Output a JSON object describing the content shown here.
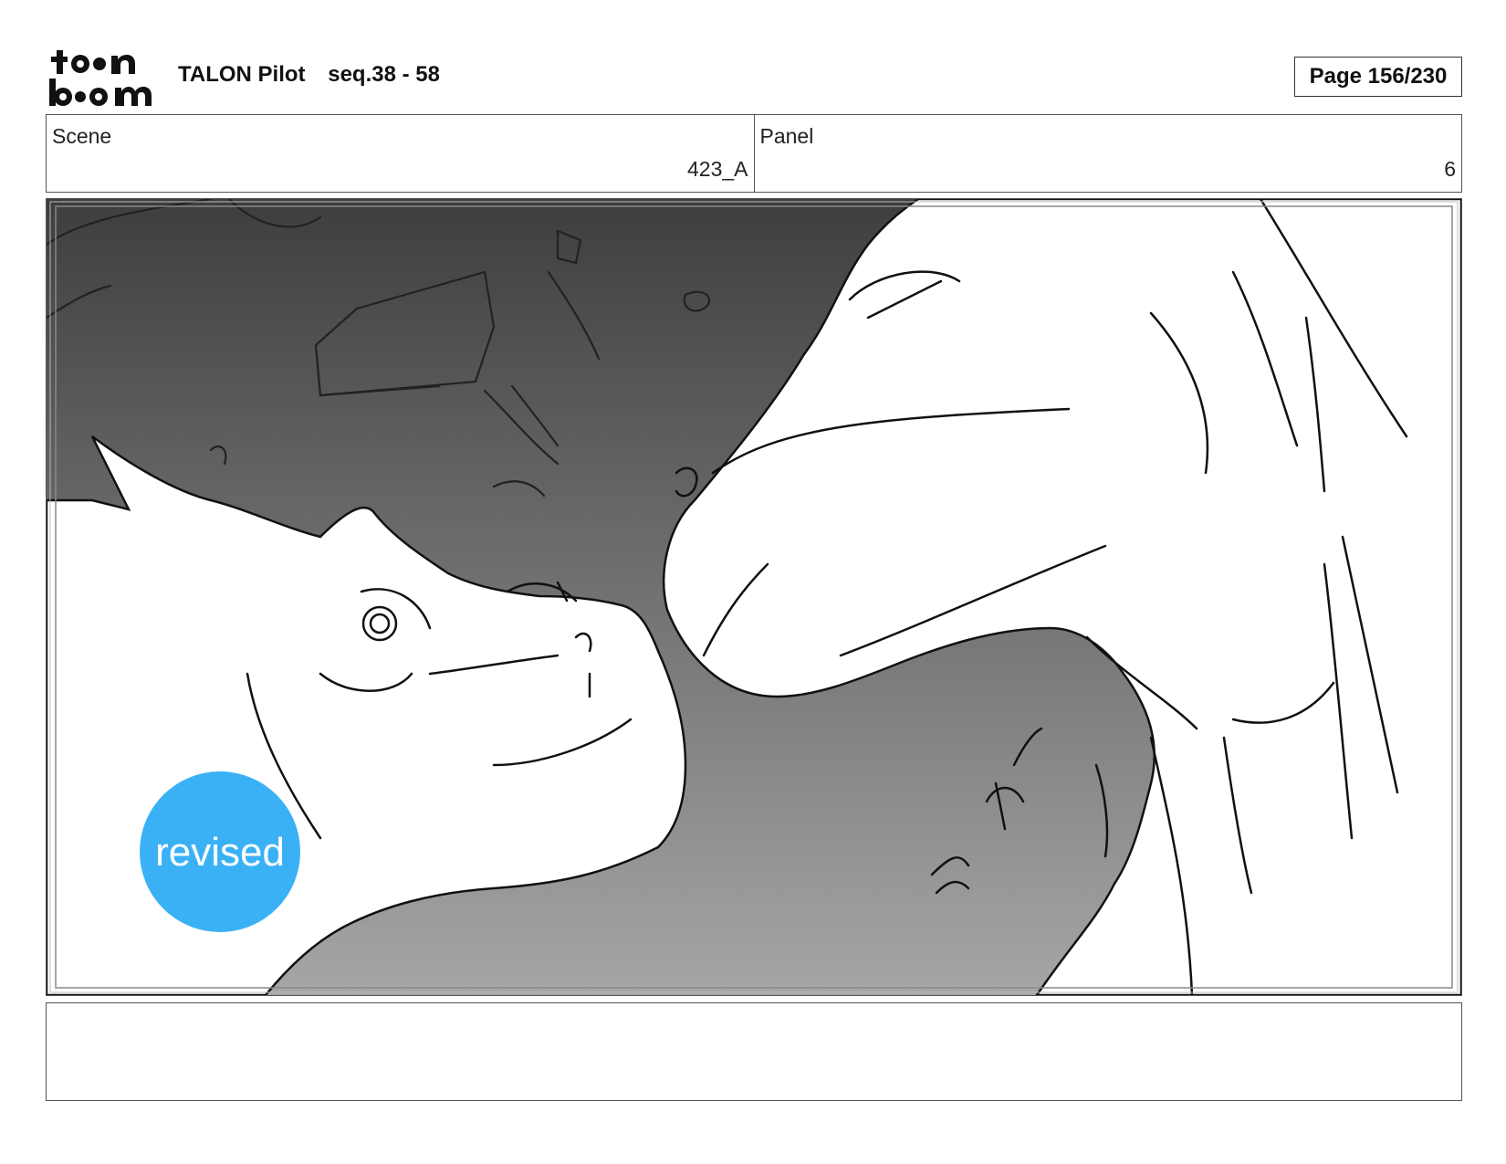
{
  "header": {
    "logo_text": "toon boom",
    "project": "TALON Pilot",
    "sequence": "seq.38 - 58",
    "page": "Page 156/230"
  },
  "scene": {
    "label": "Scene",
    "value": "423_A"
  },
  "panel": {
    "label": "Panel",
    "value": "6"
  },
  "badge": {
    "text": "revised",
    "color": "#3bb1f5"
  },
  "notes": {
    "text": ""
  },
  "colors": {
    "sky_top": "#3e3e3e",
    "sky_bottom": "#a4a4a4",
    "line": "#111111"
  }
}
